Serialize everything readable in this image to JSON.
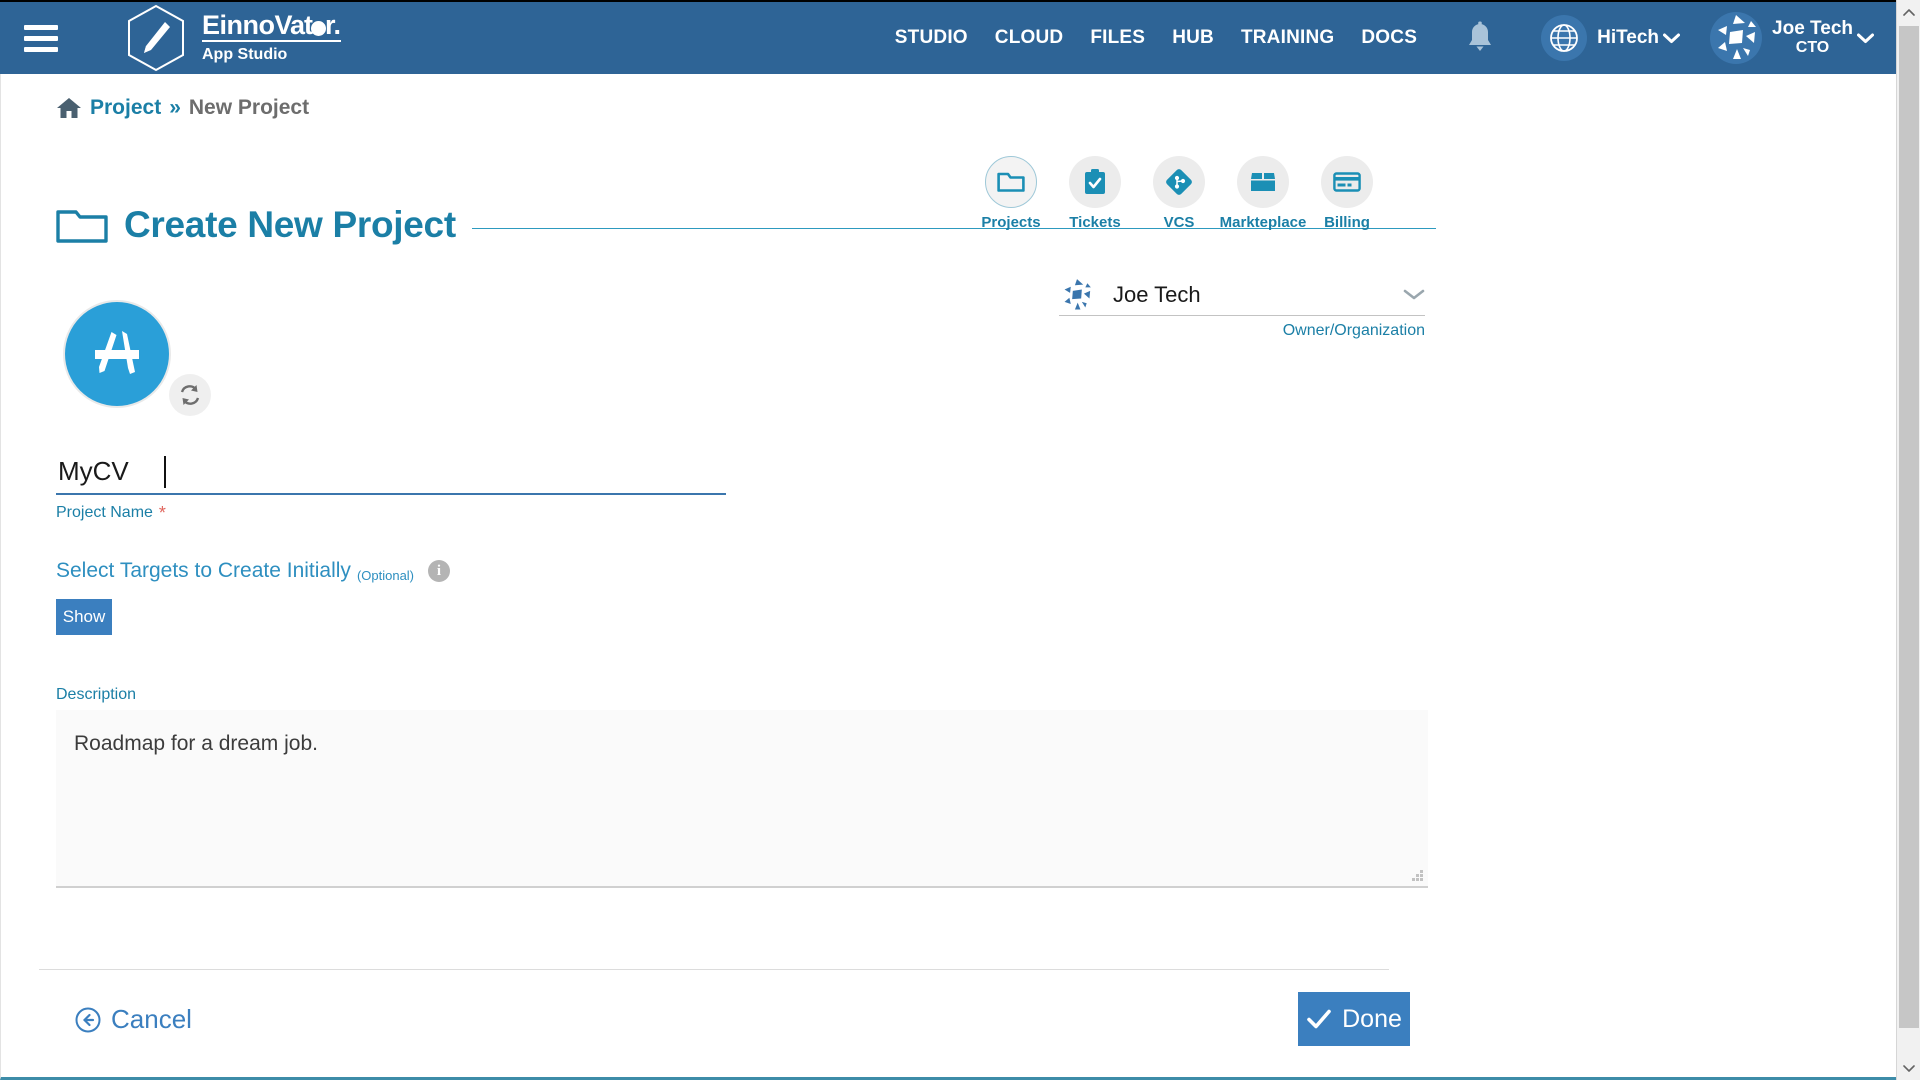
{
  "navbar": {
    "menu_icon": "hamburger-icon",
    "logo_icon": "pencil-hexagon-logo",
    "brand_part1": "Einno",
    "brand_part2": "Vat",
    "brand_part3": "r.",
    "brand_sub": "App Studio",
    "links": [
      {
        "label": "STUDIO"
      },
      {
        "label": "CLOUD"
      },
      {
        "label": "FILES"
      },
      {
        "label": "HUB"
      },
      {
        "label": "TRAINING"
      },
      {
        "label": "DOCS"
      }
    ],
    "notification_icon": "bell-icon",
    "globe_icon": "globe-icon",
    "org_name": "HiTech",
    "org_caret": "chevron-down-icon",
    "user_avatar": "user-avatar-icon",
    "user_name": "Joe Tech",
    "user_role": "CTO",
    "user_caret": "chevron-down-icon"
  },
  "breadcrumb": {
    "home_icon": "home-icon",
    "parent": "Project",
    "separator": "»",
    "current": "New Project"
  },
  "page": {
    "folder_icon": "folder-icon",
    "title": "Create New Project"
  },
  "modules": [
    {
      "label": "Projects",
      "icon": "folder-icon",
      "active": true
    },
    {
      "label": "Tickets",
      "icon": "clipboard-check-icon",
      "active": false
    },
    {
      "label": "VCS",
      "icon": "git-branch-icon",
      "active": false
    },
    {
      "label": "Markteplace",
      "icon": "box-icon",
      "active": false
    },
    {
      "label": "Billing",
      "icon": "credit-card-icon",
      "active": false
    }
  ],
  "owner": {
    "avatar_icon": "organization-avatar-icon",
    "value": "Joe Tech",
    "caret_icon": "chevron-down-icon",
    "hint": "Owner/Organization"
  },
  "project_avatar": {
    "icon": "app-store-icon",
    "refresh_icon": "refresh-icon"
  },
  "form": {
    "name_value": "MyCV",
    "name_placeholder": "",
    "name_label": "Project Name",
    "name_required_mark": "*",
    "targets_title": "Select Targets to Create Initially",
    "targets_optional": "(Optional)",
    "targets_info_icon": "info-icon",
    "targets_info_glyph": "i",
    "show_button": "Show",
    "description_label": "Description",
    "description_value": "Roadmap for a dream job.",
    "resize_grip_icon": "resize-grip-icon"
  },
  "footer": {
    "cancel_icon": "arrow-left-circle-icon",
    "cancel_label": "Cancel",
    "done_icon": "check-icon",
    "done_label": "Done"
  },
  "scrollbar": {
    "up_icon": "chevron-up-icon",
    "down_icon": "chevron-down-icon"
  },
  "colors": {
    "navbar_bg": "#2e6496",
    "accent_teal": "#1b7fa6",
    "accent_blue": "#3b7fbf",
    "avatar_blue": "#2a9fd8",
    "required_red": "#e0645c",
    "bottom_bar": "#3d8ca8"
  }
}
